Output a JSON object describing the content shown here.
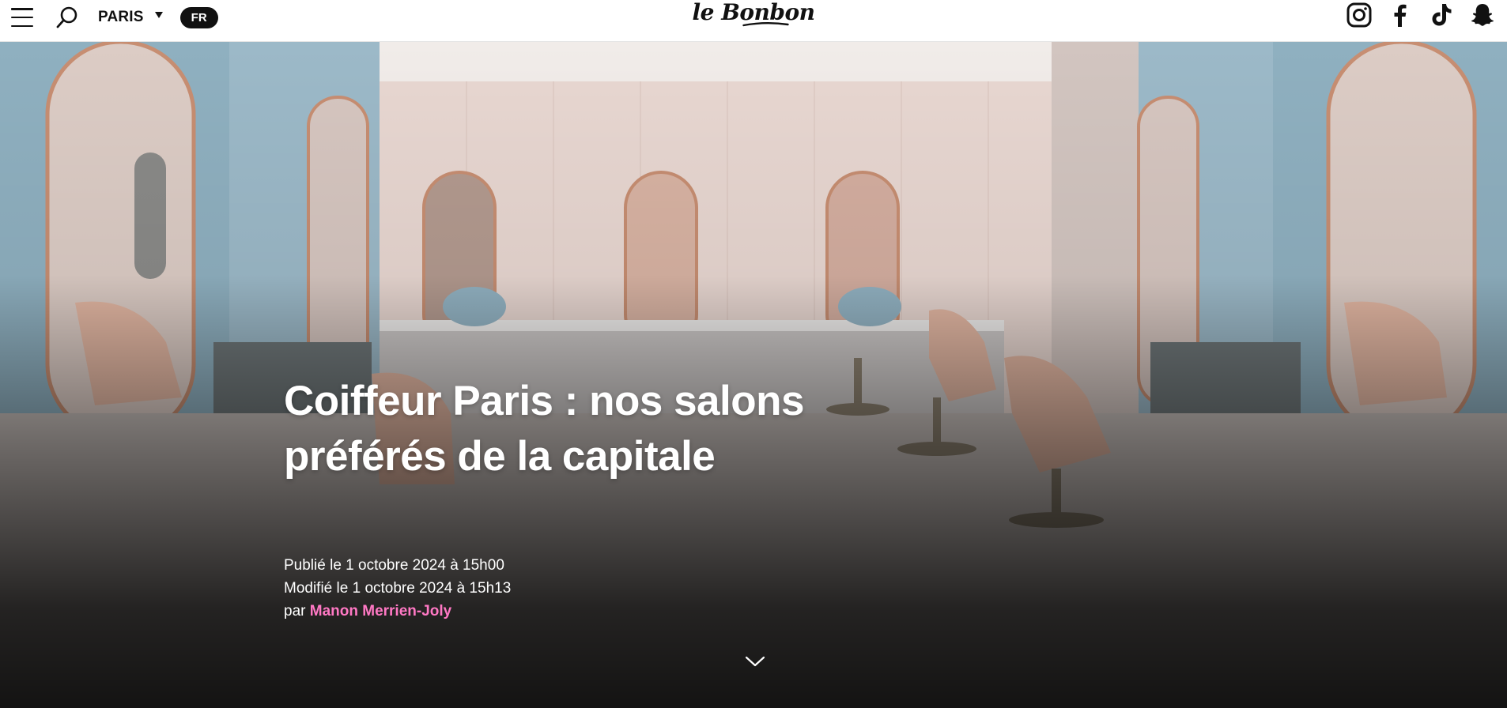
{
  "header": {
    "menu_icon": "hamburger-menu-icon",
    "search_icon": "search-icon",
    "city": "PARIS",
    "language": "FR",
    "logo": "le Bonbon",
    "socials": [
      {
        "name": "instagram-icon"
      },
      {
        "name": "facebook-icon"
      },
      {
        "name": "tiktok-icon"
      },
      {
        "name": "snapchat-icon"
      }
    ]
  },
  "article": {
    "title_line1": "Coiffeur Paris : nos salons",
    "title_line2": "préférés de la capitale",
    "published": "Publié le 1 octobre 2024 à 15h00",
    "modified": "Modifié le 1 octobre 2024 à 15h13",
    "by": "par",
    "author": "Manon Merrien-Joly",
    "scroll_icon": "chevron-down-icon"
  },
  "colors": {
    "author_link": "#ff78c4",
    "lang_badge_bg": "#111111",
    "header_bg": "#ffffff"
  }
}
